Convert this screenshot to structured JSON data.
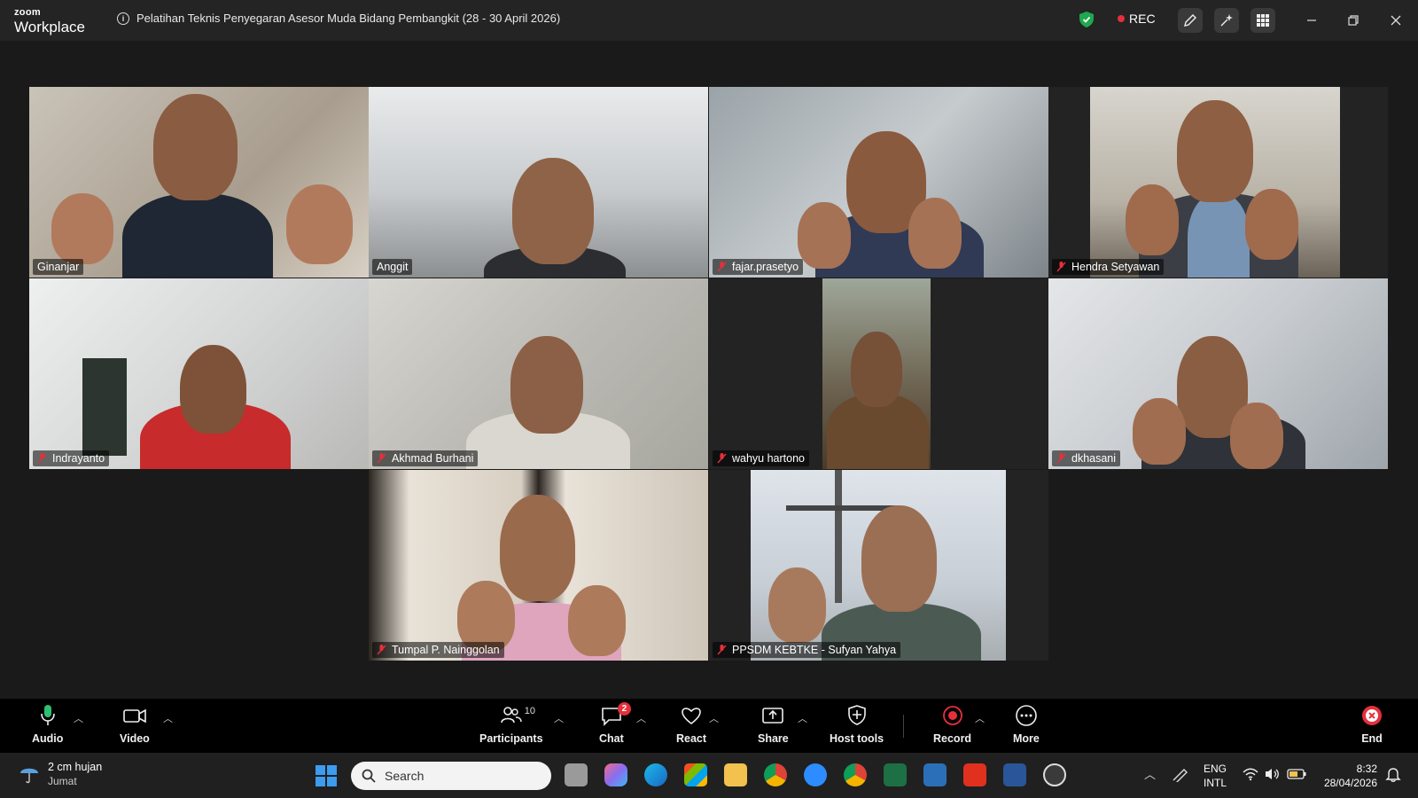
{
  "app": {
    "brand_top": "zoom",
    "brand_bottom": "Workplace"
  },
  "meeting": {
    "title": "Pelatihan Teknis Penyegaran Asesor Muda Bidang Pembangkit (28 - 30 April 2026)"
  },
  "recording": {
    "label": "REC",
    "color": "#e5303b"
  },
  "colors": {
    "active_speaker": "#28d17c",
    "shield": "#1fa84f",
    "end": "#e5303b"
  },
  "participants": [
    {
      "name": "Ginanjar",
      "muted": false
    },
    {
      "name": "Anggit",
      "muted": false,
      "active": true
    },
    {
      "name": "fajar.prasetyo",
      "muted": true
    },
    {
      "name": "Hendra Setyawan",
      "muted": true
    },
    {
      "name": "Indrayanto",
      "muted": true
    },
    {
      "name": "Akhmad Burhani",
      "muted": true
    },
    {
      "name": "wahyu hartono",
      "muted": true
    },
    {
      "name": "dkhasani",
      "muted": true
    },
    {
      "name": "Tumpal P. Nainggolan",
      "muted": true
    },
    {
      "name": "PPSDM KEBTKE - Sufyan Yahya",
      "muted": true
    }
  ],
  "controls": {
    "audio": "Audio",
    "video": "Video",
    "participants": "Participants",
    "participant_count": "10",
    "chat": "Chat",
    "chat_badge": "2",
    "react": "React",
    "share": "Share",
    "host_tools": "Host tools",
    "record": "Record",
    "more": "More",
    "end": "End"
  },
  "taskbar": {
    "weather_temp": "2 cm hujan",
    "weather_day": "Jumat",
    "search_placeholder": "Search",
    "lang_top": "ENG",
    "lang_bottom": "INTL",
    "time": "8:32",
    "date": "28/04/2026"
  }
}
